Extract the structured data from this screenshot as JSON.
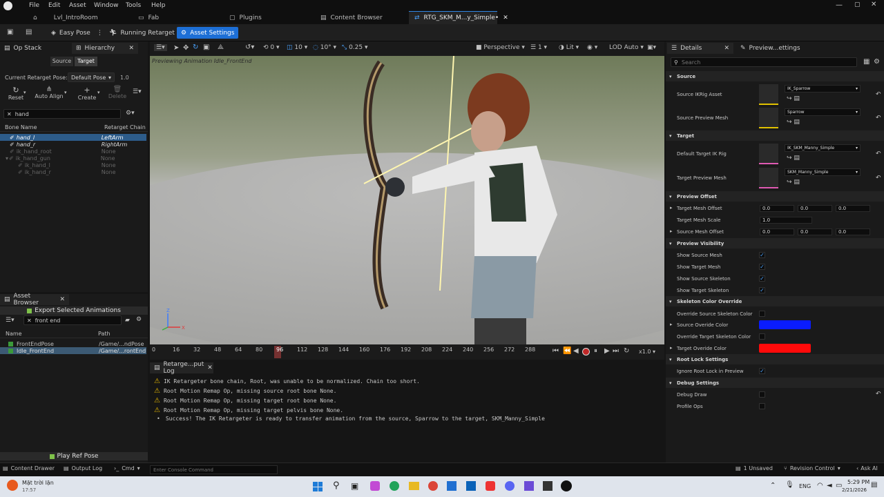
{
  "menu": [
    "File",
    "Edit",
    "Asset",
    "Window",
    "Tools",
    "Help"
  ],
  "tabs": [
    {
      "label": "Lvl_IntroRoom"
    },
    {
      "label": "Fab"
    },
    {
      "label": "Plugins"
    },
    {
      "label": "Content Browser"
    },
    {
      "label": "RTG_SKM_M...y_Simple•",
      "active": true
    }
  ],
  "toolbar": {
    "easy_pose": "Easy Pose",
    "running_retarget": "Running Retarget",
    "asset_settings": "Asset Settings"
  },
  "left": {
    "op_stack": "Op Stack",
    "hierarchy": "Hierarchy",
    "source_btn": "Source",
    "target_btn": "Target",
    "current_pose_label": "Current Retarget Pose:",
    "current_pose_value": "Default Pose",
    "pose_blend": "1.0",
    "reset": "Reset",
    "auto_align": "Auto Align",
    "create": "Create",
    "delete": "Delete",
    "search": "hand",
    "col_bone": "Bone Name",
    "col_chain": "Retarget Chain",
    "bones": [
      {
        "name": "hand_l",
        "chain": "LeftArm",
        "state": "selected"
      },
      {
        "name": "hand_r",
        "chain": "RightArm",
        "state": "active"
      },
      {
        "name": "ik_hand_root",
        "chain": "None",
        "state": "dim"
      },
      {
        "name": "ik_hand_gun",
        "chain": "None",
        "state": "dim"
      },
      {
        "name": "ik_hand_l",
        "chain": "None",
        "state": "dim"
      },
      {
        "name": "ik_hand_r",
        "chain": "None",
        "state": "dim"
      }
    ]
  },
  "asset_browser": {
    "title": "Asset Browser",
    "export": "Export Selected Animations",
    "search": "front end",
    "col_name": "Name",
    "col_path": "Path",
    "items": [
      {
        "name": "FrontEndPose",
        "path": "/Game/...ndPose"
      },
      {
        "name": "Idle_FrontEnd",
        "path": "/Game/...rontEnd",
        "selected": true
      }
    ],
    "play_ref": "Play Ref Pose"
  },
  "viewport": {
    "caption": "Previewing Animation Idle_FrontEnd",
    "perspective": "Perspective",
    "lit": "Lit",
    "lod": "LOD Auto",
    "grid_num": "0",
    "rot_num": "10",
    "scale_num": "10°",
    "cam_speed": "0.25",
    "one": "1"
  },
  "timeline": {
    "ticks": [
      "0",
      "16",
      "32",
      "48",
      "64",
      "80",
      "96",
      "112",
      "128",
      "144",
      "160",
      "176",
      "192",
      "208",
      "224",
      "240",
      "256",
      "272",
      "288"
    ],
    "speed": "x1.0"
  },
  "log": {
    "tab": "Retarge...put Log",
    "lines": [
      {
        "type": "warn",
        "text": "IK Retargeter bone chain, Root, was unable to be normalized. Chain too short."
      },
      {
        "type": "warn",
        "text": "Root Motion Remap Op, missing source root bone None."
      },
      {
        "type": "warn",
        "text": "Root Motion Remap Op, missing target root bone None."
      },
      {
        "type": "warn",
        "text": "Root Motion Remap Op, missing target pelvis bone None."
      },
      {
        "type": "info",
        "text": "Success! The IK Retargeter is ready to transfer animation from the source, Sparrow to the target, SKM_Manny_Simple"
      }
    ]
  },
  "details": {
    "tab": "Details",
    "tab2": "Preview...ettings",
    "search_placeholder": "Search",
    "sections": {
      "source": "Source",
      "target": "Target",
      "preview_offset": "Preview Offset",
      "preview_visibility": "Preview Visibility",
      "skel_color": "Skeleton Color Override",
      "root_lock": "Root Lock Settings",
      "debug": "Debug Settings"
    },
    "source_ikrig_label": "Source IKRig Asset",
    "source_ikrig_value": "IK_Sparrow",
    "source_mesh_label": "Source Preview Mesh",
    "source_mesh_value": "Sparrow",
    "target_ikrig_label": "Default Target IK Rig",
    "target_ikrig_value": "IK_SKM_Manny_Simple",
    "target_mesh_label": "Target Preview Mesh",
    "target_mesh_value": "SKM_Manny_Simple",
    "target_mesh_offset": "Target Mesh Offset",
    "target_offset_vals": [
      "0.0",
      "0.0",
      "0.0"
    ],
    "target_mesh_scale": "Target Mesh Scale",
    "target_scale_val": "1.0",
    "source_mesh_offset": "Source Mesh Offset",
    "source_offset_vals": [
      "0.0",
      "0.0",
      "0.0"
    ],
    "show_source_mesh": "Show Source Mesh",
    "show_target_mesh": "Show Target Mesh",
    "show_source_skel": "Show Source Skeleton",
    "show_target_skel": "Show Target Skeleton",
    "override_source_color": "Override Source Skeleton Color",
    "source_override_color": "Source Overide Color",
    "override_target_color": "Override Target Skeleton Color",
    "target_override_color": "Target Overide Color",
    "ignore_root_lock": "Ignore Root Lock in Preview",
    "debug_draw": "Debug Draw",
    "profile_ops": "Profile Ops",
    "colors": {
      "source": "#0a1cff",
      "target": "#ff0a0a"
    }
  },
  "statusbar": {
    "content_drawer": "Content Drawer",
    "output_log": "Output Log",
    "cmd": "Cmd",
    "console_placeholder": "Enter Console Command",
    "unsaved": "1 Unsaved",
    "revision": "Revision Control",
    "ask": "Ask AI"
  },
  "taskbar": {
    "weather": "Mặt trời lặn",
    "weather_sub": "17:57",
    "lang": "ENG",
    "time": "5:29 PM",
    "date": "2/21/2026"
  }
}
